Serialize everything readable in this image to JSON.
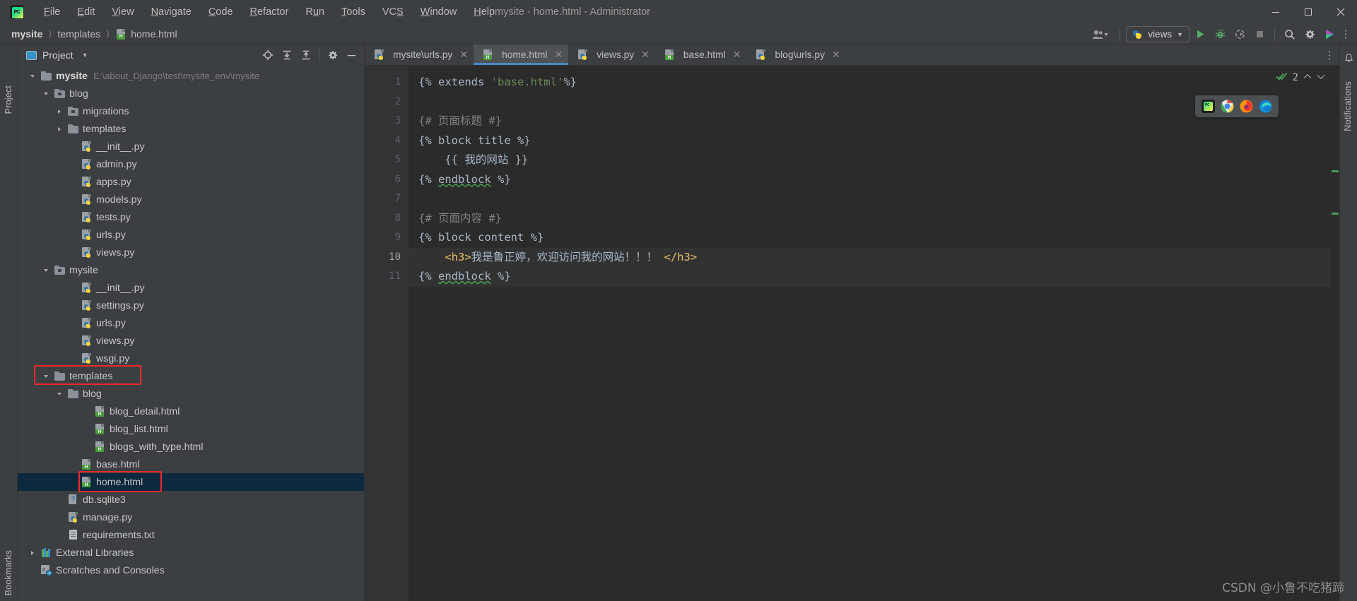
{
  "window": {
    "title": "mysite - home.html - Administrator",
    "logo_text": "PC",
    "minimize": "—",
    "maximize": "❐",
    "close": "✕"
  },
  "menu": [
    {
      "label": "File",
      "mnemonic": "F"
    },
    {
      "label": "Edit",
      "mnemonic": "E"
    },
    {
      "label": "View",
      "mnemonic": "V"
    },
    {
      "label": "Navigate",
      "mnemonic": "N"
    },
    {
      "label": "Code",
      "mnemonic": "C"
    },
    {
      "label": "Refactor",
      "mnemonic": "R"
    },
    {
      "label": "Run",
      "mnemonic": "u"
    },
    {
      "label": "Tools",
      "mnemonic": "T"
    },
    {
      "label": "VCS",
      "mnemonic": "S"
    },
    {
      "label": "Window",
      "mnemonic": "W"
    },
    {
      "label": "Help",
      "mnemonic": "H"
    }
  ],
  "breadcrumb": {
    "items": [
      "mysite",
      "templates",
      "home.html"
    ],
    "separator": "〉"
  },
  "toolbar": {
    "user_icon": "user-avatar-icon",
    "run_config": "views",
    "run": "run-icon",
    "debug": "debug-icon",
    "coverage": "run-with-coverage-icon",
    "stop": "stop-icon",
    "search": "search-everywhere-icon",
    "settings": "settings-gear-icon",
    "updates": "updates-icon"
  },
  "left_rail": {
    "label": "Project",
    "bookmarks": "Bookmarks"
  },
  "right_rail": {
    "label": "Notifications"
  },
  "project_panel": {
    "title": "Project",
    "dropdown_caret": "▾",
    "tools": [
      "locate-icon",
      "expand-all-icon",
      "collapse-all-icon",
      "settings-gear-icon",
      "hide-icon"
    ],
    "tree": [
      {
        "depth": 0,
        "arrow": "open",
        "icon": "folder",
        "label": "mysite",
        "bold": true,
        "path": "E:\\about_Django\\test\\mysite_env\\mysite"
      },
      {
        "depth": 1,
        "arrow": "open",
        "icon": "folder-src",
        "label": "blog"
      },
      {
        "depth": 2,
        "arrow": "closed",
        "icon": "folder-src",
        "label": "migrations"
      },
      {
        "depth": 2,
        "arrow": "closed",
        "icon": "folder",
        "label": "templates"
      },
      {
        "depth": 3,
        "arrow": "none",
        "icon": "python",
        "label": "__init__.py"
      },
      {
        "depth": 3,
        "arrow": "none",
        "icon": "python",
        "label": "admin.py"
      },
      {
        "depth": 3,
        "arrow": "none",
        "icon": "python",
        "label": "apps.py"
      },
      {
        "depth": 3,
        "arrow": "none",
        "icon": "python",
        "label": "models.py"
      },
      {
        "depth": 3,
        "arrow": "none",
        "icon": "python",
        "label": "tests.py"
      },
      {
        "depth": 3,
        "arrow": "none",
        "icon": "python",
        "label": "urls.py"
      },
      {
        "depth": 3,
        "arrow": "none",
        "icon": "python",
        "label": "views.py"
      },
      {
        "depth": 1,
        "arrow": "open",
        "icon": "folder-src",
        "label": "mysite"
      },
      {
        "depth": 3,
        "arrow": "none",
        "icon": "python",
        "label": "__init__.py"
      },
      {
        "depth": 3,
        "arrow": "none",
        "icon": "python",
        "label": "settings.py"
      },
      {
        "depth": 3,
        "arrow": "none",
        "icon": "python",
        "label": "urls.py"
      },
      {
        "depth": 3,
        "arrow": "none",
        "icon": "python",
        "label": "views.py"
      },
      {
        "depth": 3,
        "arrow": "none",
        "icon": "python",
        "label": "wsgi.py"
      },
      {
        "depth": 1,
        "arrow": "open",
        "icon": "folder",
        "label": "templates",
        "highlight": true
      },
      {
        "depth": 2,
        "arrow": "open",
        "icon": "folder",
        "label": "blog"
      },
      {
        "depth": 4,
        "arrow": "none",
        "icon": "html",
        "label": "blog_detail.html"
      },
      {
        "depth": 4,
        "arrow": "none",
        "icon": "html",
        "label": "blog_list.html"
      },
      {
        "depth": 4,
        "arrow": "none",
        "icon": "html",
        "label": "blogs_with_type.html"
      },
      {
        "depth": 3,
        "arrow": "none",
        "icon": "html",
        "label": "base.html"
      },
      {
        "depth": 3,
        "arrow": "none",
        "icon": "html",
        "label": "home.html",
        "selected": true,
        "highlight": true
      },
      {
        "depth": 2,
        "arrow": "none",
        "icon": "db",
        "label": "db.sqlite3"
      },
      {
        "depth": 2,
        "arrow": "none",
        "icon": "python",
        "label": "manage.py"
      },
      {
        "depth": 2,
        "arrow": "none",
        "icon": "txt",
        "label": "requirements.txt"
      },
      {
        "depth": 0,
        "arrow": "closed",
        "icon": "library",
        "label": "External Libraries"
      },
      {
        "depth": 0,
        "arrow": "none",
        "icon": "scratch",
        "label": "Scratches and Consoles"
      }
    ]
  },
  "editor": {
    "tabs": [
      {
        "label": "mysite\\urls.py",
        "icon": "python",
        "active": false
      },
      {
        "label": "home.html",
        "icon": "html",
        "active": true
      },
      {
        "label": "views.py",
        "icon": "python",
        "active": false
      },
      {
        "label": "base.html",
        "icon": "html",
        "active": false
      },
      {
        "label": "blog\\urls.py",
        "icon": "python",
        "active": false
      }
    ],
    "tab_close": "✕",
    "more_tabs": "⋮",
    "inspection": {
      "count": "2",
      "check_icon": "inspection-ok-icon",
      "prev": "⌃",
      "next": "⌄"
    },
    "browsers": [
      "pycharm-icon",
      "chrome-icon",
      "firefox-icon",
      "edge-icon"
    ],
    "gutter_lines": [
      "1",
      "2",
      "3",
      "4",
      "5",
      "6",
      "7",
      "8",
      "9",
      "10",
      "11"
    ],
    "current_line": 10,
    "lines": [
      {
        "n": 1,
        "segments": [
          {
            "t": "{% extends ",
            "c": "tpl"
          },
          {
            "t": "'base.html'",
            "c": "str"
          },
          {
            "t": "%}",
            "c": "tpl"
          }
        ]
      },
      {
        "n": 2,
        "segments": []
      },
      {
        "n": 3,
        "segments": [
          {
            "t": "{# 页面标题 #}",
            "c": "cmt"
          }
        ]
      },
      {
        "n": 4,
        "segments": [
          {
            "t": "{% block title %}",
            "c": "tpl"
          }
        ]
      },
      {
        "n": 5,
        "segments": [
          {
            "t": "    {{ 我的网站 }}",
            "c": "tpl"
          }
        ]
      },
      {
        "n": 6,
        "segments": [
          {
            "t": "{% ",
            "c": "tpl"
          },
          {
            "t": "endblock",
            "c": "tpl sq-under"
          },
          {
            "t": " %}",
            "c": "tpl"
          }
        ]
      },
      {
        "n": 7,
        "segments": []
      },
      {
        "n": 8,
        "segments": [
          {
            "t": "{# 页面内容 #}",
            "c": "cmt"
          }
        ]
      },
      {
        "n": 9,
        "segments": [
          {
            "t": "{% block content %}",
            "c": "tpl"
          }
        ]
      },
      {
        "n": 10,
        "highlight": true,
        "segments": [
          {
            "t": "    ",
            "c": "tpl"
          },
          {
            "t": "<h3>",
            "c": "tag"
          },
          {
            "t": "我是鲁正婷，欢迎访问我的网站！！！",
            "c": "txt"
          },
          {
            "t": " </h3>",
            "c": "tag"
          }
        ]
      },
      {
        "n": 11,
        "highlight": true,
        "segments": [
          {
            "t": "{% ",
            "c": "tpl"
          },
          {
            "t": "endblock",
            "c": "tpl sq-under"
          },
          {
            "t": " %}",
            "c": "tpl"
          }
        ]
      }
    ]
  },
  "watermark": "CSDN @小鲁不吃猪蹄",
  "colors": {
    "accent": "#4a88c7",
    "selection": "#0d293e",
    "highlight_box": "#ef2929",
    "editor_bg": "#2b2b2b",
    "panel_bg": "#3c3f41",
    "ok_green": "#499c54",
    "string_green": "#6a8759",
    "tag_gold": "#e8bf6a"
  }
}
